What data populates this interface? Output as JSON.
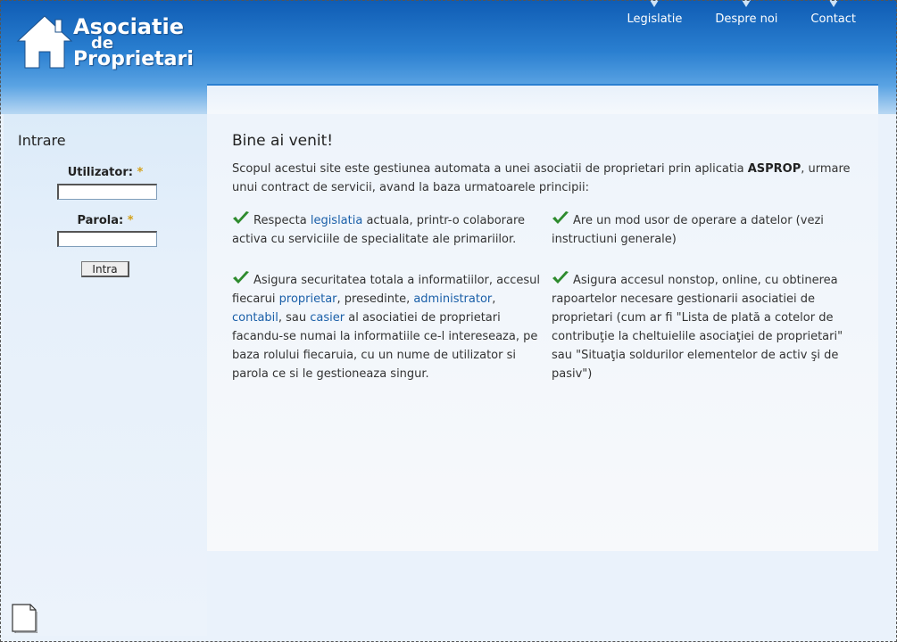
{
  "header": {
    "logo": {
      "line1": "Asociatie",
      "line2": "de",
      "line3": "Proprietari"
    },
    "nav": [
      {
        "label": "Legislatie"
      },
      {
        "label": "Despre noi"
      },
      {
        "label": "Contact"
      }
    ]
  },
  "sidebar": {
    "title": "Intrare",
    "username_label": "Utilizator:",
    "password_label": "Parola:",
    "required_mark": "*",
    "username_value": "",
    "password_value": "",
    "submit_label": "Intra"
  },
  "main": {
    "title": "Bine ai venit!",
    "intro_text": "Scopul acestui site este gestiunea automata a unei asociatii de proprietari prin aplicatia ",
    "intro_bold": "ASPROP",
    "intro_rest": ", urmare unui contract de servicii, avand la baza urmatoarele principii:",
    "principles": {
      "p1_a": "Respecta ",
      "p1_link": "legislatia",
      "p1_b": " actuala, printr-o colaborare activa cu serviciile de specialitate ale primariilor.",
      "p2": "Are un mod usor de operare a datelor (vezi instructiuni generale)",
      "p3_a": "Asigura securitatea totala a informatiilor, accesul fiecarui ",
      "p3_link1": "proprietar",
      "p3_b": ", presedinte, ",
      "p3_link2": "administrator",
      "p3_c": ", ",
      "p3_link3": "contabil",
      "p3_d": ", sau ",
      "p3_link4": "casier",
      "p3_e": " al asociatiei de proprietari facandu-se numai la informatiile ce-l intereseaza, pe baza rolului fiecaruia, cu un nume de utilizator si parola ce si le gestioneaza singur.",
      "p4": "Asigura accesul nonstop, online, cu obtinerea rapoartelor necesare gestionarii asociatiei de proprietari (cum ar fi \"Lista de plată a cotelor de contribuţie la cheltuielile asociaţiei de proprietari\" sau \"Situaţia soldurilor elementelor de activ şi de pasiv\")"
    }
  },
  "icons": {
    "check": "check-icon",
    "logo_house": "house-icon",
    "page": "page-icon"
  },
  "colors": {
    "header_blue": "#0f5cb4",
    "link": "#1a5fa8",
    "check_green": "#2e8b2e",
    "required": "#d4a017"
  }
}
